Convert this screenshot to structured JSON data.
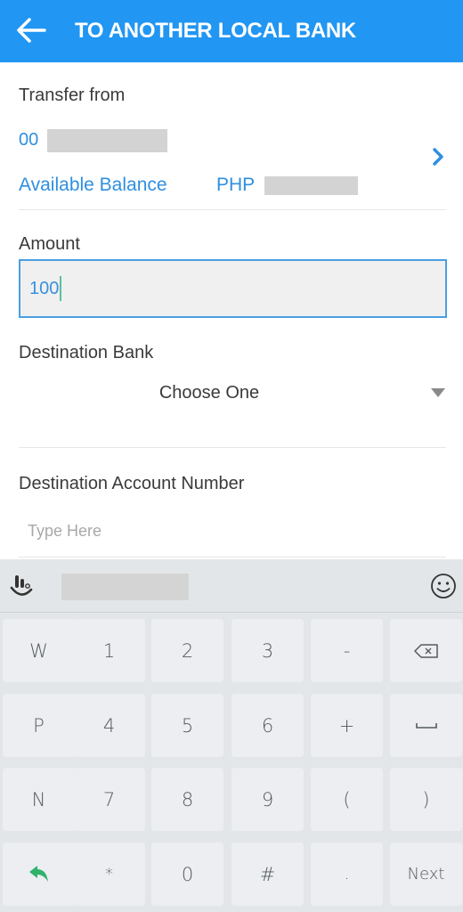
{
  "appbar": {
    "title": "TO ANOTHER LOCAL BANK",
    "back_icon": "arrow-left-icon",
    "color": "#2196f3"
  },
  "transfer_from": {
    "label": "Transfer from",
    "account_prefix": "00",
    "balance_label": "Available Balance",
    "balance_currency": "PHP",
    "chevron_icon": "chevron-right-icon"
  },
  "amount": {
    "label": "Amount",
    "value": "100"
  },
  "destination_bank": {
    "label": "Destination Bank",
    "selected": "Choose One",
    "arrow_icon": "dropdown-arrow-icon"
  },
  "destination_account": {
    "label": "Destination Account Number",
    "placeholder": "Type Here",
    "value": ""
  },
  "keyboard": {
    "logo_icon": "keyboard-logo-icon",
    "emoji_icon": "emoji-icon",
    "rows": [
      [
        "W",
        "1",
        "2",
        "3",
        "-",
        "backspace"
      ],
      [
        "P",
        "4",
        "5",
        "6",
        "+",
        "space"
      ],
      [
        "N",
        "7",
        "8",
        "9",
        "(",
        ")"
      ],
      [
        "back",
        "*",
        "0",
        "#",
        ".",
        "Next"
      ]
    ],
    "accent": "#2fb36b"
  }
}
